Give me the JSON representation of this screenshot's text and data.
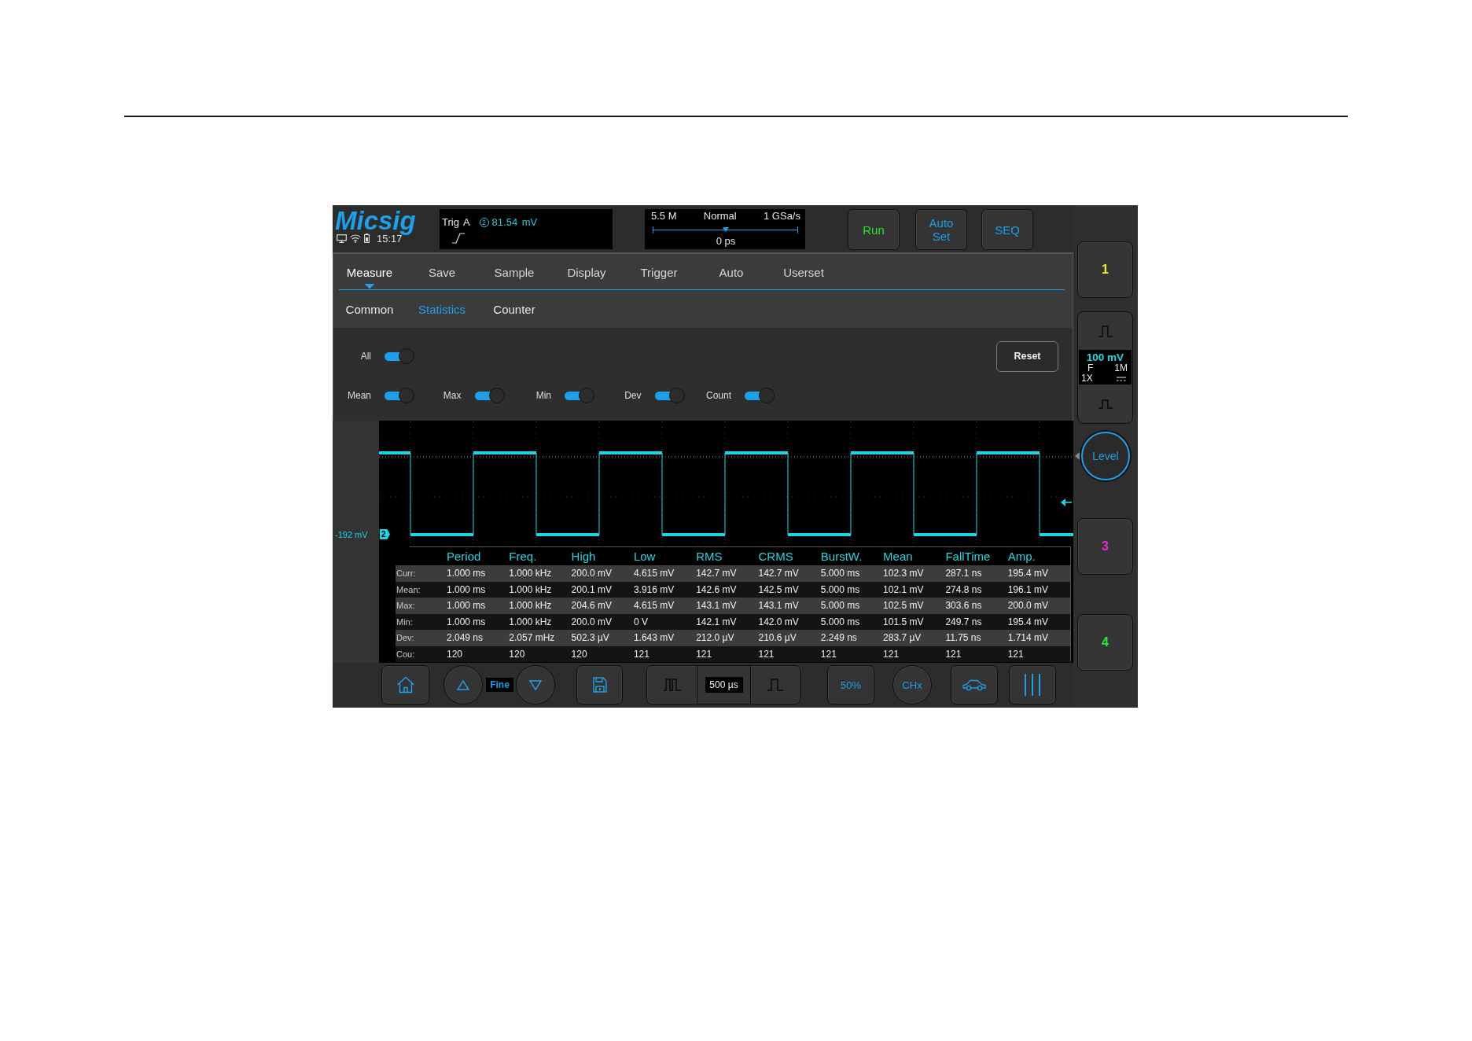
{
  "top_bar": {
    "logo": "Micsig",
    "time": "15:17",
    "trigger": {
      "label": "Trig",
      "source": "A",
      "channel": "2",
      "level": "81.54 mV"
    },
    "acquisition": {
      "memory": "5.5 M",
      "mode": "Normal",
      "sample_rate": "1 GSa/s",
      "level": 0.5,
      "position": "0 ps"
    },
    "buttons": [
      {
        "label": "Run",
        "color": "#2ee02e"
      },
      {
        "label": "Auto Set",
        "color": "#1e9fe8"
      },
      {
        "label": "SEQ",
        "color": "#1e9fe8"
      }
    ]
  },
  "menu": {
    "tabs": [
      {
        "label": "Measure",
        "selected": true
      },
      {
        "label": "Save",
        "selected": false
      },
      {
        "label": "Sample",
        "selected": false
      },
      {
        "label": "Display",
        "selected": false
      },
      {
        "label": "Trigger",
        "selected": false
      },
      {
        "label": "Auto",
        "selected": false
      },
      {
        "label": "Userset",
        "selected": false
      }
    ],
    "subtabs": [
      {
        "label": "Common",
        "selected": false
      },
      {
        "label": "Statistics",
        "selected": true
      },
      {
        "label": "Counter",
        "selected": false
      }
    ]
  },
  "statistics": {
    "all": {
      "label": "All",
      "on": true
    },
    "reset": "Reset",
    "toggles": [
      {
        "label": "Mean",
        "on": true
      },
      {
        "label": "Max",
        "on": true
      },
      {
        "label": "Min",
        "on": true
      },
      {
        "label": "Dev",
        "on": true
      },
      {
        "label": "Count",
        "on": true
      }
    ]
  },
  "waveform": {
    "offset_label": "-192 mV",
    "channel_marker": "2"
  },
  "measurements": {
    "columns": [
      "Period",
      "Freq.",
      "High",
      "Low",
      "RMS",
      "CRMS",
      "BurstW.",
      "Mean",
      "FallTime",
      "Amp."
    ],
    "rows": [
      {
        "label": "Curr:",
        "values": [
          "1.000 ms",
          "1.000 kHz",
          "200.0 mV",
          "4.615 mV",
          "142.7 mV",
          "142.7 mV",
          "5.000 ms",
          "102.3 mV",
          "287.1 ns",
          "195.4 mV"
        ]
      },
      {
        "label": "Mean:",
        "values": [
          "1.000 ms",
          "1.000 kHz",
          "200.1 mV",
          "3.916 mV",
          "142.6 mV",
          "142.5 mV",
          "5.000 ms",
          "102.1 mV",
          "274.8 ns",
          "196.1 mV"
        ]
      },
      {
        "label": "Max:",
        "values": [
          "1.000 ms",
          "1.000 kHz",
          "204.6 mV",
          "4.615 mV",
          "143.1 mV",
          "143.1 mV",
          "5.000 ms",
          "102.5 mV",
          "303.6 ns",
          "200.0 mV"
        ]
      },
      {
        "label": "Min:",
        "values": [
          "1.000 ms",
          "1.000 kHz",
          "200.0 mV",
          "0 V",
          "142.1 mV",
          "142.0 mV",
          "5.000 ms",
          "101.5 mV",
          "249.7 ns",
          "195.4 mV"
        ]
      },
      {
        "label": "Dev:",
        "values": [
          "2.049 ns",
          "2.057 mHz",
          "502.3 µV",
          "1.643 mV",
          "212.0 µV",
          "210.6 µV",
          "2.249 ns",
          "283.7 µV",
          "11.75 ns",
          "1.714 mV"
        ]
      },
      {
        "label": "Cou:",
        "values": [
          "120",
          "120",
          "120",
          "121",
          "121",
          "121",
          "121",
          "121",
          "121",
          "121"
        ]
      }
    ]
  },
  "bottom_bar": {
    "step_mode": "Fine",
    "timebase": "500 µs",
    "trigger_50": "50%",
    "channel_select": "CHx"
  },
  "channel_column": [
    {
      "kind": "channel",
      "label": "1",
      "color": "#f2ee2a"
    },
    {
      "kind": "channel_panel",
      "scale": "100 mV",
      "color": "#22d8e8",
      "bandwidth": "F",
      "impedance": "1M",
      "probe": "1X"
    },
    {
      "kind": "knob",
      "label": "Level"
    },
    {
      "kind": "channel",
      "label": "3",
      "color": "#e82ed8"
    },
    {
      "kind": "channel",
      "label": "4",
      "color": "#33e833"
    }
  ]
}
